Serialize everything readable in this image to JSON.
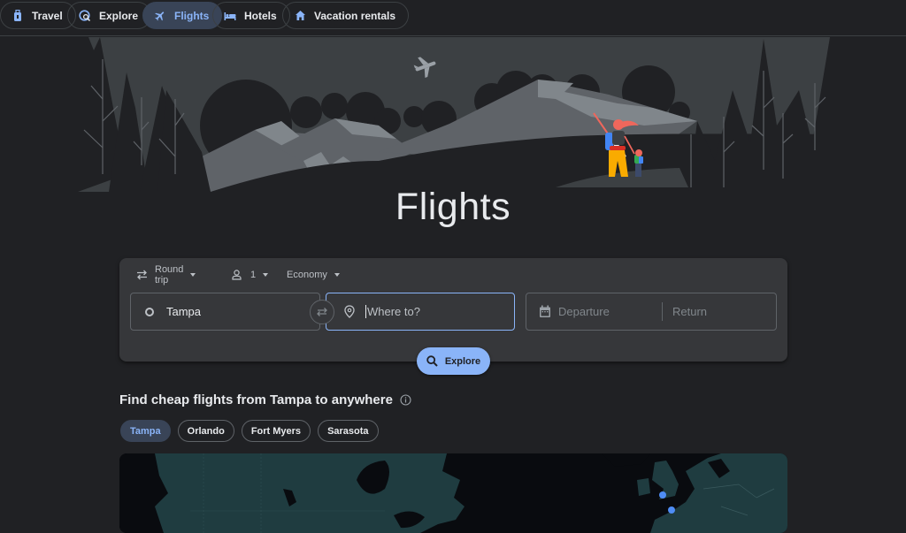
{
  "nav": {
    "tabs": [
      {
        "label": "Travel",
        "icon": "luggage-icon",
        "active": false
      },
      {
        "label": "Explore",
        "icon": "explore-icon",
        "active": false
      },
      {
        "label": "Flights",
        "icon": "airplane-icon",
        "active": true
      },
      {
        "label": "Hotels",
        "icon": "bed-icon",
        "active": false
      },
      {
        "label": "Vacation rentals",
        "icon": "house-icon",
        "active": false
      }
    ]
  },
  "page": {
    "title": "Flights"
  },
  "search": {
    "trip_type": "Round trip",
    "passengers": "1",
    "cabin_class": "Economy",
    "origin_value": "Tampa",
    "destination_placeholder": "Where to?",
    "departure_placeholder": "Departure",
    "return_placeholder": "Return",
    "explore_label": "Explore"
  },
  "cheap_flights": {
    "title": "Find cheap flights from Tampa to anywhere",
    "chips": [
      {
        "label": "Tampa",
        "active": true
      },
      {
        "label": "Orlando",
        "active": false
      },
      {
        "label": "Fort Myers",
        "active": false
      },
      {
        "label": "Sarasota",
        "active": false
      }
    ]
  },
  "colors": {
    "accent": "#8ab4f8",
    "active_chip_bg": "#394457",
    "background": "#202124",
    "card": "#36373a",
    "map_land": "#1f3c40",
    "map_pin": "#4f8df5"
  }
}
